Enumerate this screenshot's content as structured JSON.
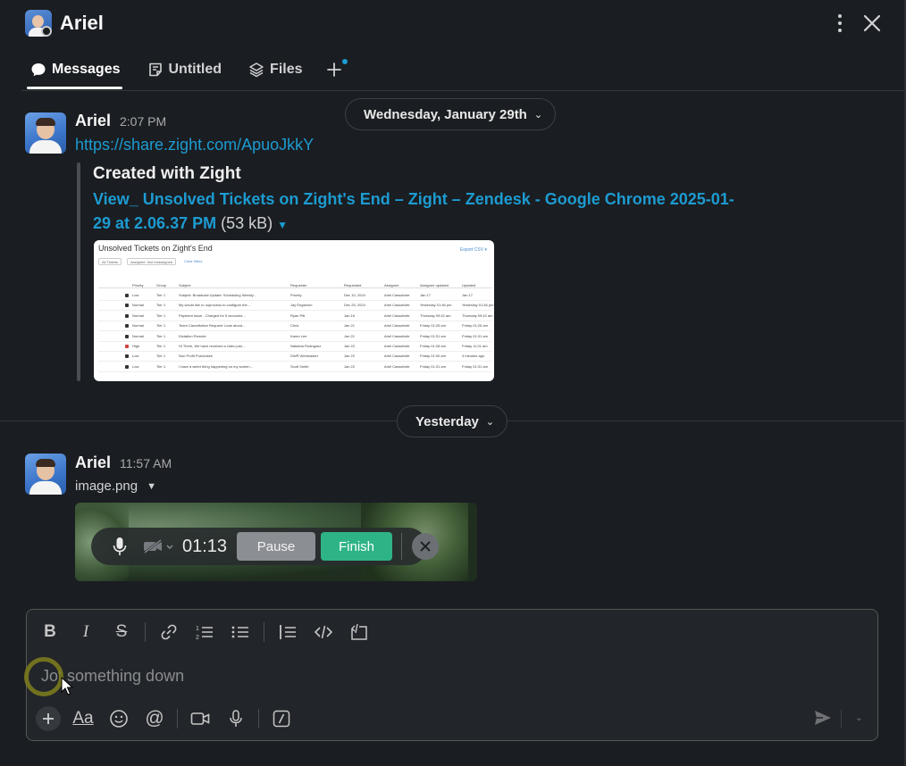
{
  "header": {
    "title": "Ariel",
    "tabs": [
      {
        "label": "Messages",
        "icon": "message-bubble-icon",
        "active": true
      },
      {
        "label": "Untitled",
        "icon": "canvas-note-icon",
        "active": false
      },
      {
        "label": "Files",
        "icon": "layers-icon",
        "active": false
      }
    ]
  },
  "dividers": {
    "first": "Wednesday, January 29th",
    "second": "Yesterday"
  },
  "messages": [
    {
      "author": "Ariel",
      "time": "2:07 PM",
      "link": "https://share.zight.com/ApuoJkkY",
      "unfurl": {
        "title": "Created with Zight",
        "file_link": "View_ Unsolved Tickets on Zight's End – Zight – Zendesk - Google Chrome 2025-01-29 at 2.06.37 PM",
        "size": "(53 kB)",
        "preview": {
          "title": "Unsolved Tickets on Zight's End",
          "filters": [
            "All Tickets",
            "Assignee: Not Unassigned",
            "Clear filters"
          ],
          "headers": [
            "Priority",
            "Group",
            "Subject",
            "Requester",
            "Requested",
            "Assignee",
            "Assignee updated",
            "Updated"
          ],
          "rows": [
            [
              "Low",
              "Tier 1",
              "Subject: Broadcast Update: Scheduling Weekly...",
              "Priority",
              "Dec 10, 2024",
              "Ariel Cassaforte",
              "Jan 17",
              "Jan 17"
            ],
            [
              "Normal",
              "Tier 1",
              "My would like to unprocess to configure the...",
              "Jay Engstrom",
              "Dec 25, 2024",
              "Ariel Cassaforte",
              "Yesterday 01:46 pm",
              "Yesterday 01:46 pm"
            ],
            [
              "Normal",
              "Tier 1",
              "Payment issue - Charged for 5 accounts...",
              "Ryan Pitt",
              "Jan 16",
              "Ariel Cassaforte",
              "Thursday 09:42 am",
              "Thursday 09:42 am"
            ],
            [
              "Normal",
              "Tier 1",
              "Team Cancellation Request: Lean about...",
              "Chris",
              "Jan 21",
              "Ariel Cassaforte",
              "Friday 01:25 am",
              "Friday 01:25 am"
            ],
            [
              "Normal",
              "Tier 1",
              "Dictation Remote",
              "Karen Lee",
              "Jan 21",
              "Ariel Cassaforte",
              "Friday 01:31 am",
              "Friday 01:31 am"
            ],
            [
              "High",
              "Tier 1",
              "Hi There, We have received a video just...",
              "Natasha Rodriguez",
              "Jan 22",
              "Ariel Cassaforte",
              "Friday 01:28 am",
              "Friday 11:01 am"
            ],
            [
              "Low",
              "Tier 1",
              "Non Profit Purchases",
              "DWR Webmaster",
              "Jan 22",
              "Ariel Cassaforte",
              "Friday 01:00 am",
              "4 minutes ago"
            ],
            [
              "Low",
              "Tier 1",
              "I have a weird thing happening on my screen...",
              "Scott Smith",
              "Jan 22",
              "Ariel Cassaforte",
              "Friday 01:31 am",
              "Friday 01:31 am"
            ]
          ]
        }
      }
    },
    {
      "author": "Ariel",
      "time": "11:57 AM",
      "file_name": "image.png",
      "recorder": {
        "timer": "01:13",
        "pause_label": "Pause",
        "finish_label": "Finish"
      }
    }
  ],
  "composer": {
    "placeholder": "Jot something down",
    "format_tools": [
      "bold-icon",
      "italic-icon",
      "strikethrough-icon",
      "link-icon",
      "ordered-list-icon",
      "bulleted-list-icon",
      "blockquote-icon",
      "code-icon",
      "code-block-icon"
    ],
    "bottom_tools": [
      "plus-icon",
      "text-format-icon",
      "emoji-icon",
      "mention-icon",
      "video-icon",
      "microphone-icon",
      "slash-command-icon"
    ]
  },
  "colors": {
    "background": "#1a1d21",
    "link": "#1d9bd1",
    "finish": "#2eb386"
  }
}
